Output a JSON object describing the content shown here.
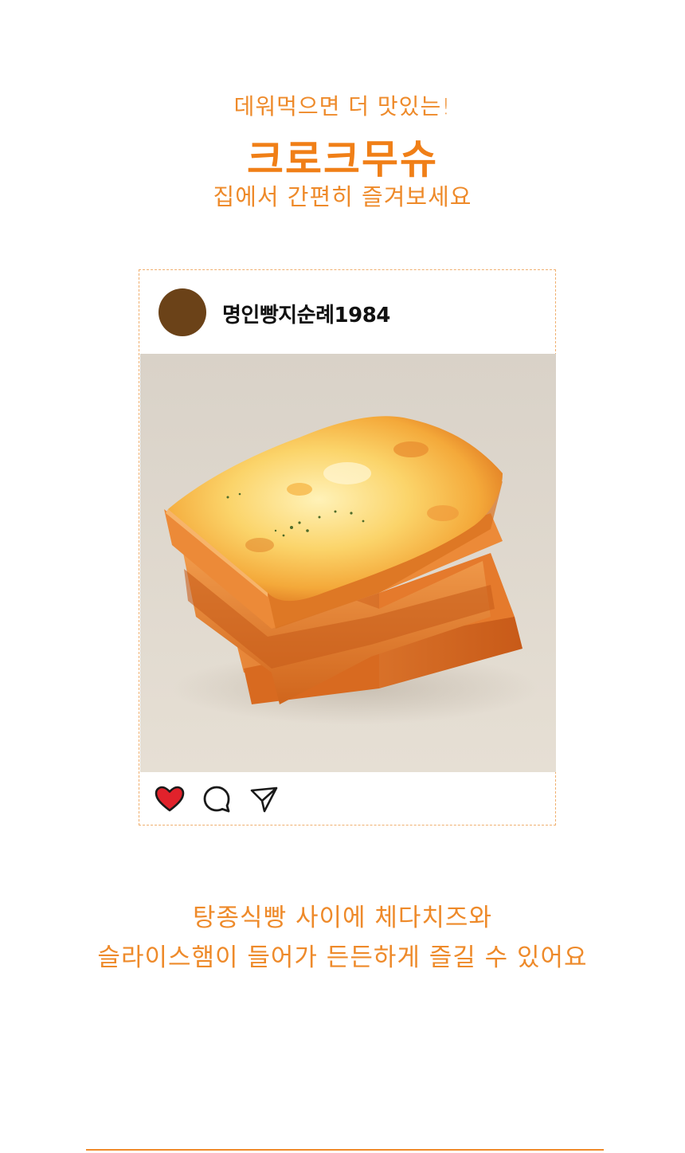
{
  "header": {
    "eyebrow": "데워먹으면 더 맛있는!",
    "title": "크로크무슈",
    "subtitle": "집에서 간편히 즐겨보세요"
  },
  "post": {
    "username": "명인빵지순례1984",
    "avatar_color": "#6b4218",
    "photo_subject": "croque-monsieur",
    "actions": [
      {
        "name": "like",
        "icon": "heart-icon",
        "state": "liked"
      },
      {
        "name": "comment",
        "icon": "comment-bubble-icon"
      },
      {
        "name": "share",
        "icon": "paper-plane-icon"
      }
    ]
  },
  "description": {
    "line1": "탕종식빵 사이에 체다치즈와",
    "line2": "슬라이스햄이 들어가 든든하게 즐길 수 있어요"
  },
  "colors": {
    "accent": "#f07f17",
    "text_orange": "#ee8a2a",
    "heart": "#e0222b",
    "card_border": "#f0b070"
  }
}
